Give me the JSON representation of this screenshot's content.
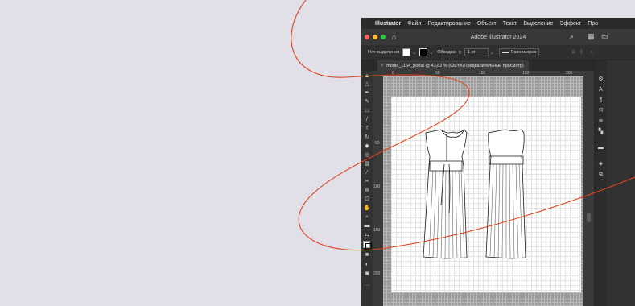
{
  "menubar": {
    "app_name": "Illustrator",
    "items": [
      "Файл",
      "Редактирование",
      "Объект",
      "Текст",
      "Выделение",
      "Эффект",
      "Про"
    ]
  },
  "window": {
    "title": "Adobe Illustrator 2024",
    "traffic_lights": [
      "#ff5f57",
      "#febc2e",
      "#28c840"
    ]
  },
  "control_bar": {
    "selection_label": "Нет выделения",
    "stroke_label": "Обводка:",
    "stroke_value": "1 pt",
    "profile_label": "Равномерно"
  },
  "document_tab": {
    "label": "model_1164_portal @ 43,82 % (CMYK/Предварительный просмотр)"
  },
  "ruler": {
    "h_ticks": [
      "0",
      "50",
      "100",
      "150",
      "200"
    ],
    "v_ticks": [
      "50",
      "100",
      "150",
      "200"
    ]
  },
  "colors": {
    "accent_line": "#e0451d",
    "background": "#e1e0e8"
  }
}
